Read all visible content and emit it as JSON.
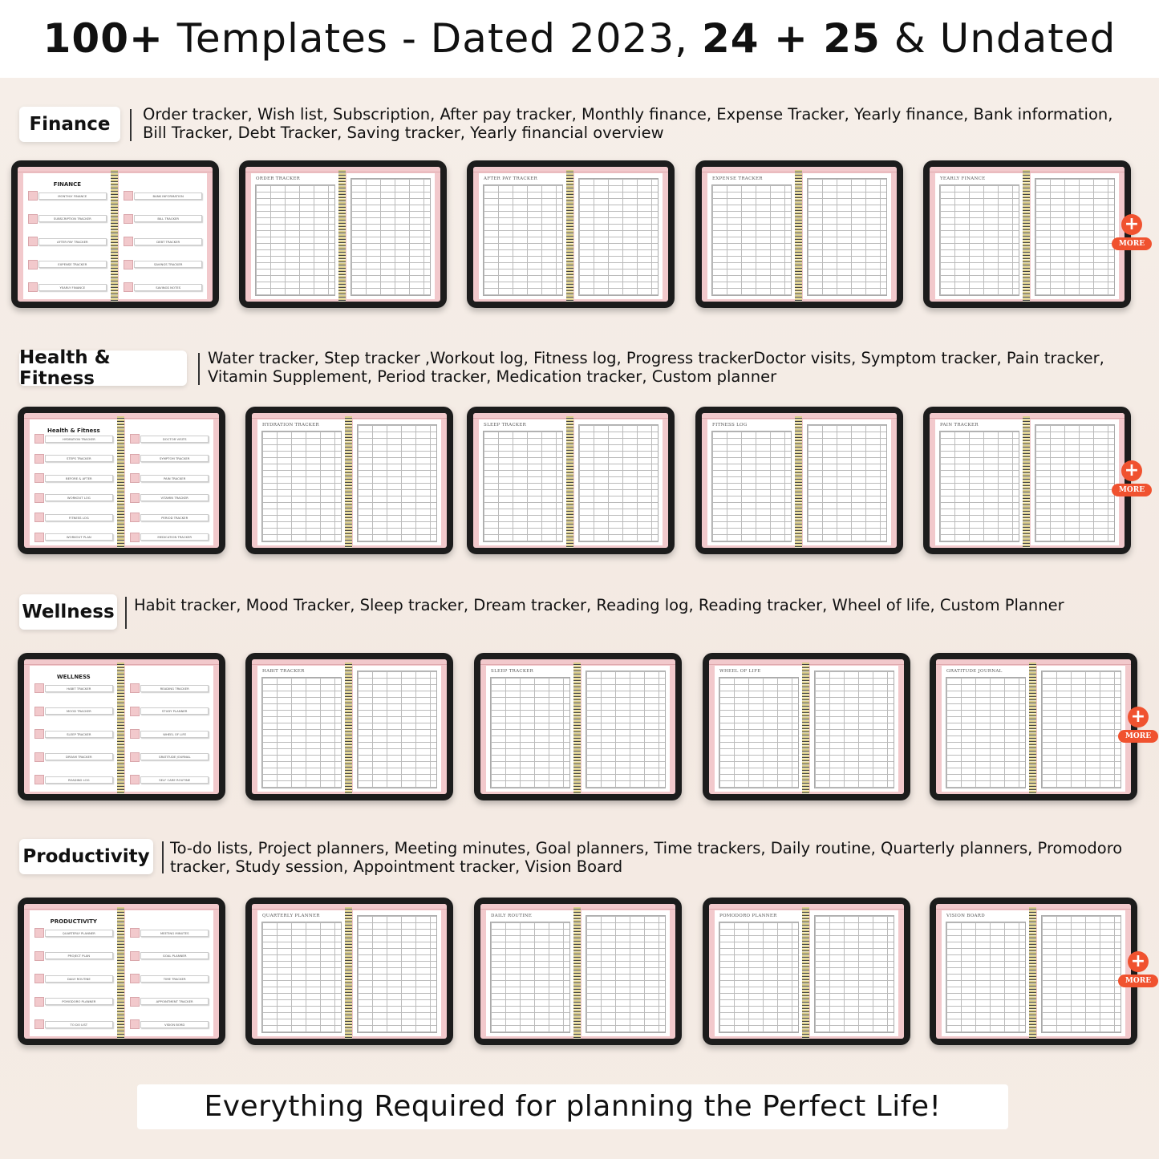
{
  "header": {
    "title_a": "100+",
    "title_b": " Templates - Dated 2023, ",
    "title_c": "24 + 25",
    "title_d": " & Undated"
  },
  "sections": [
    {
      "label": "Finance",
      "description": "Order tracker, Wish list, Subscription, After pay tracker, Monthly finance, Expense Tracker, Yearly finance, Bank information, Bill Tracker, Debt Tracker, Saving tracker, Yearly financial overview",
      "index_title": "FINANCE",
      "index_items": [
        "MONTHLY FINANCE",
        "SUBSCRIPTION TRACKER",
        "AFTER PAY TRACKER",
        "EXPENSE TRACKER",
        "YEARLY FINANCE",
        "BANK INFORMATION",
        "BILL TRACKER",
        "DEBT TRACKER",
        "SAVINGS TRACKER",
        "SAVINGS NOTES"
      ],
      "pages": [
        "ORDER TRACKER",
        "AFTER PAY TRACKER",
        "EXPENSE TRACKER",
        "YEARLY FINANCE"
      ]
    },
    {
      "label": "Health & Fitness",
      "description": "Water tracker, Step tracker ,Workout log, Fitness log, Progress trackerDoctor visits, Symptom tracker, Pain tracker, Vitamin Supplement, Period tracker, Medication tracker, Custom planner",
      "index_title": "Health & Fitness",
      "index_items": [
        "HYDRATION TRACKER",
        "STEPS TRACKER",
        "BEFORE & AFTER",
        "WORKOUT LOG",
        "FITNESS LOG",
        "WORKOUT PLAN",
        "DOCTOR VISITS",
        "SYMPTOM TRACKER",
        "PAIN TRACKER",
        "VITAMIN TRACKER",
        "PERIOD TRACKER",
        "MEDICATION TRACKER"
      ],
      "pages": [
        "HYDRATION TRACKER",
        "SLEEP TRACKER",
        "FITNESS LOG",
        "PAIN TRACKER"
      ]
    },
    {
      "label": "Wellness",
      "description": "Habit tracker, Mood Tracker, Sleep tracker, Dream tracker, Reading log, Reading tracker, Wheel of life, Custom Planner",
      "index_title": "WELLNESS",
      "index_items": [
        "HABIT TRACKER",
        "MOOD TRACKER",
        "SLEEP TRACKER",
        "DREAM TRACKER",
        "READING LOG",
        "READING TRACKER",
        "STUDY PLANNER",
        "WHEEL OF LIFE",
        "GRATITUDE JOURNAL",
        "SELF CARE ROUTINE"
      ],
      "pages": [
        "HABIT TRACKER",
        "SLEEP TRACKER",
        "WHEEL OF LIFE",
        "GRATITUDE JOURNAL"
      ]
    },
    {
      "label": "Productivity",
      "description": "To-do lists, Project planners, Meeting minutes, Goal planners, Time trackers, Daily routine, Quarterly planners, Promodoro tracker, Study session, Appointment tracker, Vision Board",
      "index_title": "PRODUCTIVITY",
      "index_items": [
        "QUARTERLY PLANNER",
        "PROJECT PLAN",
        "DAILY ROUTINE",
        "POMODORO PLANNER",
        "TO DO LIST",
        "MEETING MINUTES",
        "GOAL PLANNER",
        "TIME TRACKER",
        "APPOINTMENT TRACKER",
        "VISION BORD"
      ],
      "pages": [
        "QUARTERLY PLANNER",
        "DAILY ROUTINE",
        "POMODORO PLANNER",
        "VISION BOARD"
      ]
    }
  ],
  "more_label": "MORE",
  "banner": "Everything Required for planning the Perfect Life!",
  "colors": {
    "accent": "#f0522f",
    "pink": "#f2c9cc",
    "bezel": "#1c1c1c"
  }
}
